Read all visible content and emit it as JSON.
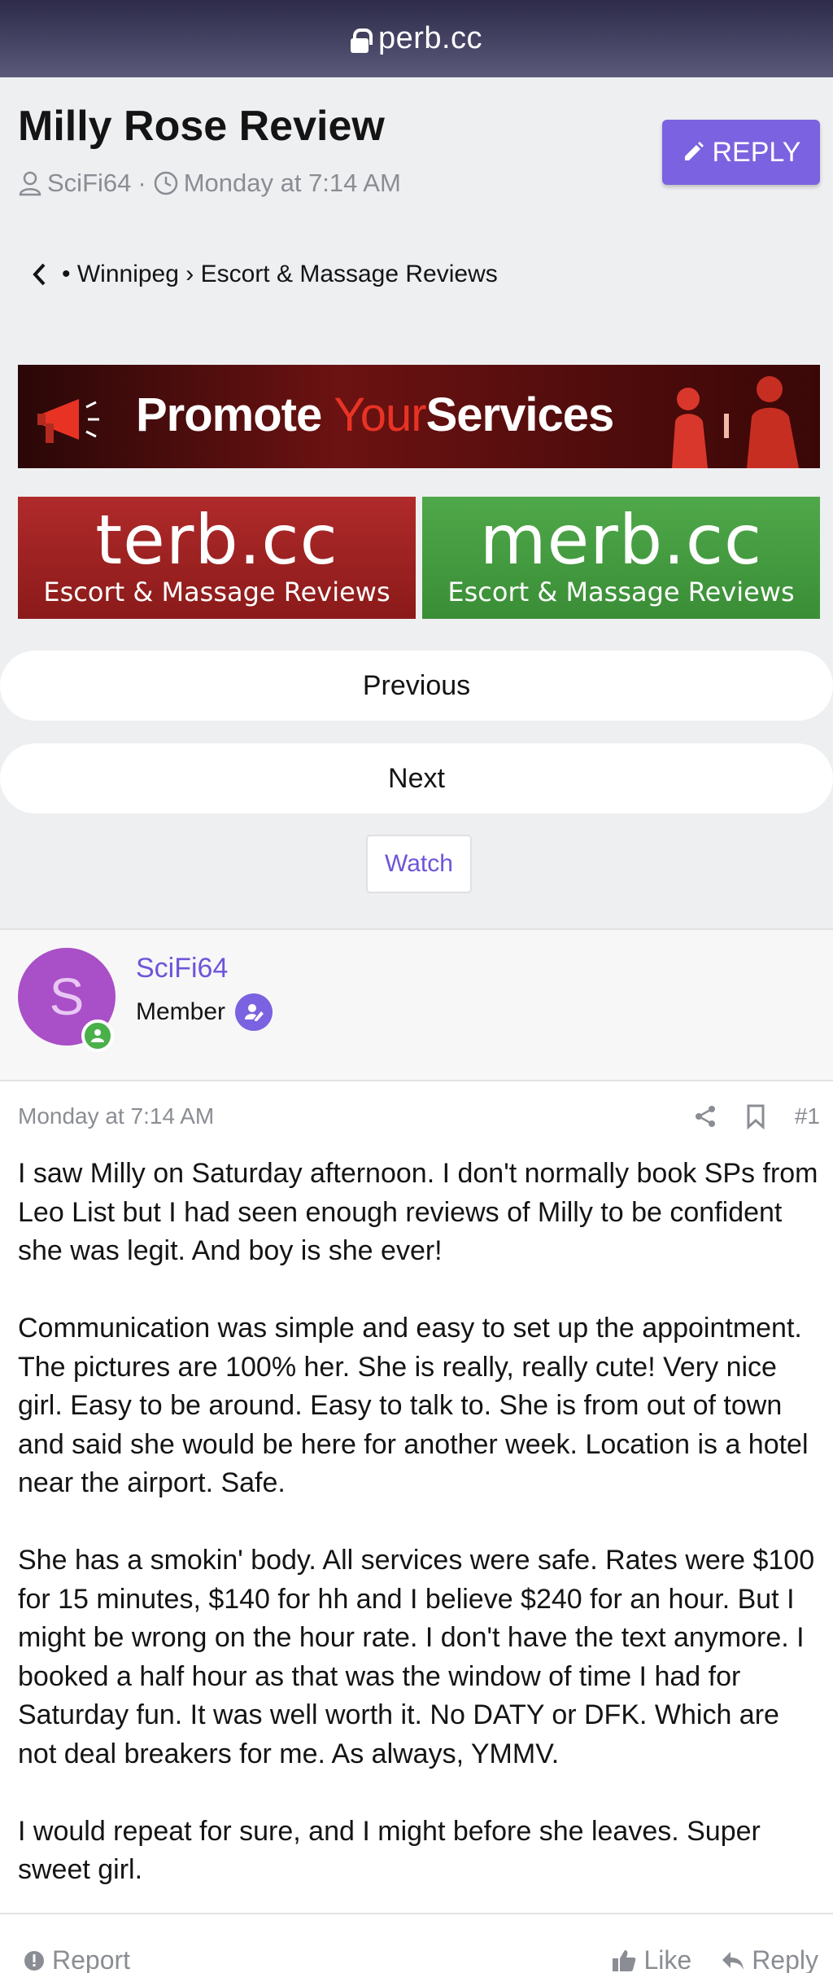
{
  "browser": {
    "host": "perb.cc"
  },
  "thread": {
    "title": "Milly Rose Review",
    "author": "SciFi64",
    "date": "Monday at 7:14 AM",
    "reply_label": "REPLY"
  },
  "breadcrumb": {
    "bullet": "•",
    "parent": "Winnipeg",
    "separator": "›",
    "current": "Escort & Massage Reviews"
  },
  "banners": {
    "promote": {
      "word1": "Promote",
      "word2": "Your",
      "word3": "Services"
    },
    "terb": {
      "name": "terb.cc",
      "tagline": "Escort & Massage Reviews"
    },
    "merb": {
      "name": "merb.cc",
      "tagline": "Escort & Massage Reviews"
    }
  },
  "nav": {
    "previous": "Previous",
    "next": "Next",
    "watch": "Watch"
  },
  "post": {
    "author": "SciFi64",
    "avatar_letter": "S",
    "role": "Member",
    "date": "Monday at 7:14 AM",
    "number": "#1",
    "paragraphs": [
      "I saw Milly on Saturday afternoon. I don't normally book SPs from Leo List but I had seen enough reviews of Milly to be confident she was legit. And boy is she ever!",
      "Communication was simple and easy to set up the appointment. The pictures are 100% her. She is really, really cute! Very nice girl. Easy to be around. Easy to talk to. She is from out of town and said she would be here for another week. Location is a hotel near the airport. Safe.",
      "She has a smokin' body. All services were safe. Rates were $100 for 15 minutes, $140 for hh and I believe $240 for an hour. But I might be wrong on the hour rate. I don't have the text anymore. I booked a half hour as that was the window of time I had for Saturday fun. It was well worth it. No DATY or DFK. Which are not deal breakers for me. As always, YMMV.",
      "I would repeat for sure, and I might before she leaves. Super sweet girl."
    ],
    "report": "Report",
    "like": "Like",
    "reply": "Reply"
  },
  "colors": {
    "accent": "#7b62e0",
    "avatar": "#a94fc7",
    "online": "#4ab04a"
  }
}
